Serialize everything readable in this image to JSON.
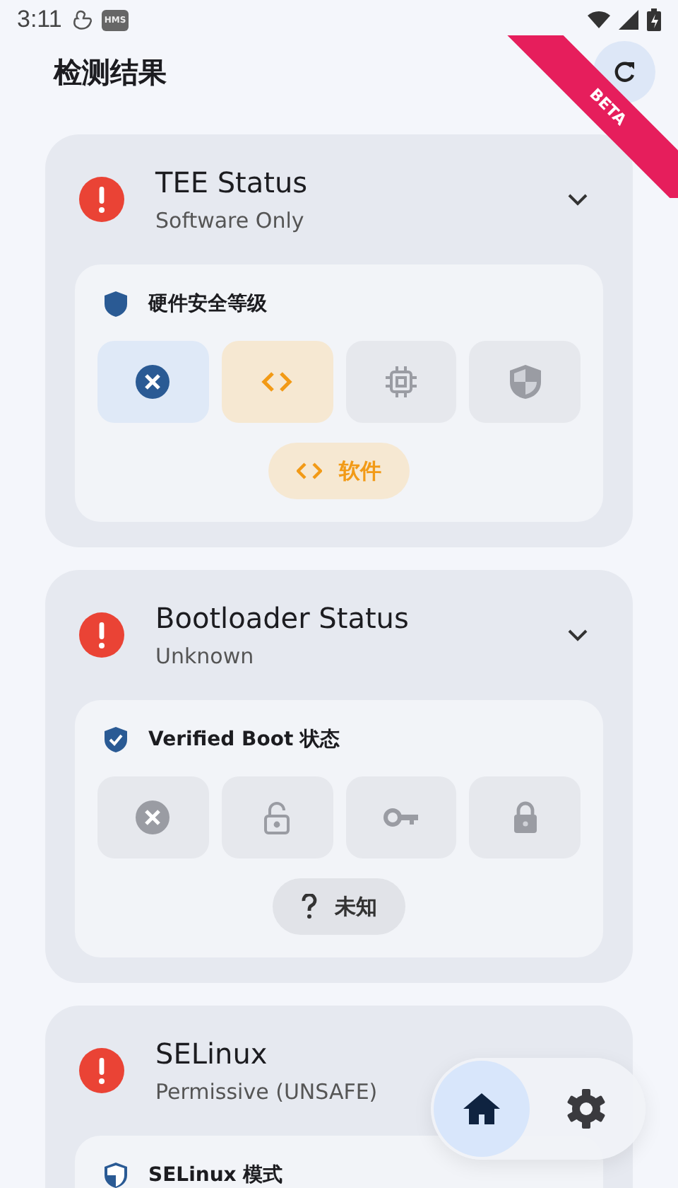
{
  "status_bar": {
    "time": "3:11",
    "badge": "HMS"
  },
  "header": {
    "title": "检测结果",
    "ribbon": "BETA"
  },
  "cards": [
    {
      "title": "TEE Status",
      "subtitle": "Software Only",
      "kind": "error",
      "expanded": true,
      "section": {
        "kind": "shield",
        "label": "硬件安全等级",
        "tiles": [
          {
            "kind": "cross",
            "highlighted": true,
            "selected": false
          },
          {
            "kind": "code",
            "highlighted": false,
            "selected": true
          },
          {
            "kind": "chip",
            "highlighted": false,
            "selected": false
          },
          {
            "kind": "halfshield",
            "highlighted": false,
            "selected": false
          }
        ],
        "result": {
          "kind": "code",
          "text": "软件"
        }
      }
    },
    {
      "title": "Bootloader Status",
      "subtitle": "Unknown",
      "kind": "error",
      "expanded": true,
      "section": {
        "kind": "checkshield",
        "label": "Verified Boot 状态",
        "tiles": [
          {
            "kind": "cross",
            "highlighted": false,
            "selected": false
          },
          {
            "kind": "unlock",
            "highlighted": false,
            "selected": false
          },
          {
            "kind": "key",
            "highlighted": false,
            "selected": false
          },
          {
            "kind": "lock",
            "highlighted": false,
            "selected": false
          }
        ],
        "result": {
          "kind": "question",
          "text": "未知"
        }
      }
    },
    {
      "title": "SELinux",
      "subtitle": "Permissive (UNSAFE)",
      "kind": "error",
      "expanded": true,
      "section": {
        "kind": "halfshield",
        "label": "SELinux 模式"
      }
    }
  ],
  "nav": [
    {
      "kind": "home",
      "selected": true
    },
    {
      "kind": "settings",
      "selected": false
    }
  ]
}
